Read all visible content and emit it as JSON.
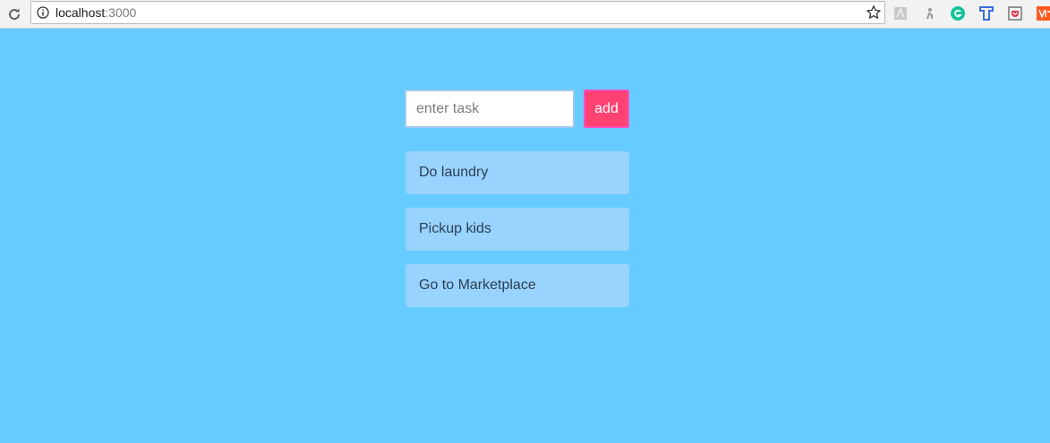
{
  "browser": {
    "url_host": "localhost",
    "url_port": ":3000",
    "extensions": [
      {
        "name": "pdf-icon",
        "color": "#c9c9c9"
      },
      {
        "name": "person-icon",
        "color": "#9a9a9a"
      },
      {
        "name": "grammarly-icon",
        "color": "#15c39a"
      },
      {
        "name": "t-icon",
        "color": "#3b6ddf"
      },
      {
        "name": "pocket-icon",
        "color": "#d8334a"
      },
      {
        "name": "orange-square-icon",
        "color": "#ff5a1f"
      }
    ]
  },
  "form": {
    "input_placeholder": "enter task",
    "input_value": "",
    "add_label": "add"
  },
  "tasks": [
    {
      "label": "Do laundry"
    },
    {
      "label": "Pickup kids"
    },
    {
      "label": "Go to Marketplace"
    }
  ],
  "colors": {
    "background": "#66ccff",
    "task_bg": "#99d3ff",
    "add_button": "#ff4272"
  }
}
